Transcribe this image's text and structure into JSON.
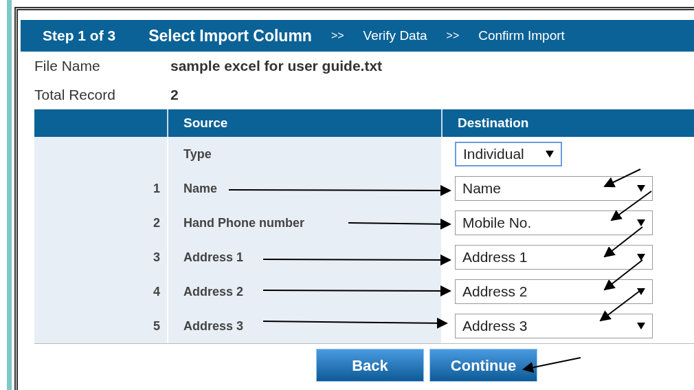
{
  "header": {
    "step_counter": "Step 1 of 3",
    "steps": [
      {
        "label": "Select Import Column",
        "selected": true
      },
      {
        "label": "Verify Data",
        "selected": false
      },
      {
        "label": "Confirm Import",
        "selected": false
      }
    ],
    "separators": [
      ">>",
      ">>"
    ]
  },
  "file_info": [
    {
      "label": "File Name",
      "value": "sample excel for user guide.txt"
    },
    {
      "label": "Total Record",
      "value": "2"
    }
  ],
  "table": {
    "columns": [
      "Source",
      "Destination"
    ],
    "type_row": {
      "label": "Type",
      "value": "Individual",
      "focused": true
    },
    "rows": [
      {
        "number": "1",
        "source": "Name",
        "destination": "Name"
      },
      {
        "number": "2",
        "source": "Hand Phone number",
        "destination": "Mobile No."
      },
      {
        "number": "3",
        "source": "Address 1",
        "destination": "Address 1"
      },
      {
        "number": "4",
        "source": "Address 2",
        "destination": "Address 2"
      },
      {
        "number": "5",
        "source": "Address 3",
        "destination": "Address 3"
      }
    ]
  },
  "buttons": [
    "Back",
    "Continue"
  ]
}
